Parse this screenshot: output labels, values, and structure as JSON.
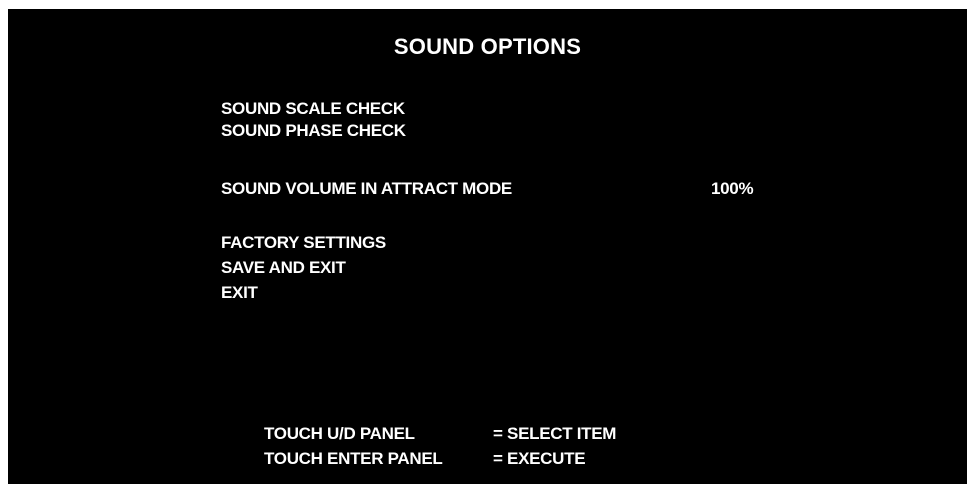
{
  "title": "SOUND OPTIONS",
  "menu": {
    "sound_scale_check": "SOUND SCALE CHECK",
    "sound_phase_check": "SOUND PHASE CHECK",
    "sound_volume_attract": "SOUND VOLUME IN ATTRACT MODE",
    "sound_volume_value": "100%",
    "factory_settings": "FACTORY SETTINGS",
    "save_and_exit": "SAVE AND EXIT",
    "exit": "EXIT"
  },
  "instructions": [
    {
      "control": "TOUCH U/D PANEL",
      "action": "= SELECT ITEM"
    },
    {
      "control": "TOUCH ENTER PANEL",
      "action": "= EXECUTE"
    }
  ],
  "colors": {
    "background": "#000000",
    "text": "#ffffff"
  }
}
